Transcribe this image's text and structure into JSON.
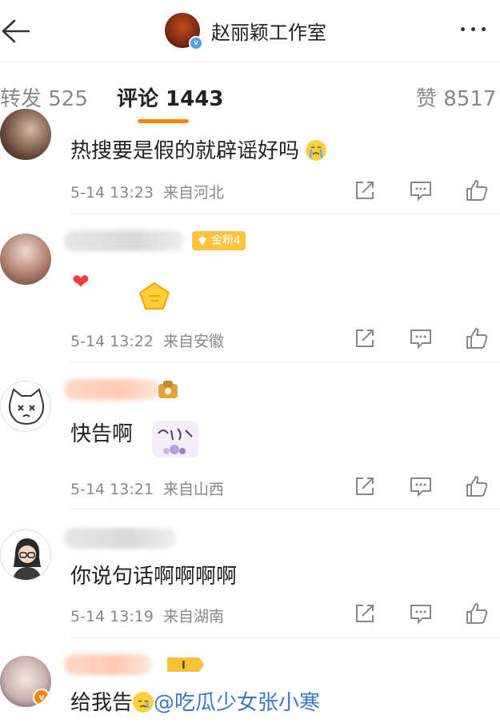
{
  "header": {
    "title": "赵丽颖工作室",
    "back_icon": "back-arrow-icon",
    "more_icon": "more-dots-icon",
    "verified_color": "#4f9fe6"
  },
  "tabs": {
    "repost": "转发 525",
    "comment": "评论 1443",
    "like": "赞 8517",
    "accent": "#ff8200"
  },
  "comments": [
    {
      "text": "热搜要是假的就辟谣好吗",
      "emoji": "crying-emoji",
      "time": "5-14 13:23",
      "location": "来自河北"
    },
    {
      "text": "",
      "badge": "金粉4",
      "emoji": "heart-emoji",
      "time": "5-14 13:22",
      "location": "来自安徽"
    },
    {
      "text": "快告啊",
      "time": "5-14 13:21",
      "location": "来自山西"
    },
    {
      "text": "你说句话啊啊啊啊",
      "time": "5-14 13:19",
      "location": "来自湖南"
    },
    {
      "text": "给我告",
      "mention": "@吃瓜少女张小寒",
      "rank_badge": "I"
    }
  ],
  "actions": [
    "share-icon",
    "reply-icon",
    "like-icon"
  ]
}
